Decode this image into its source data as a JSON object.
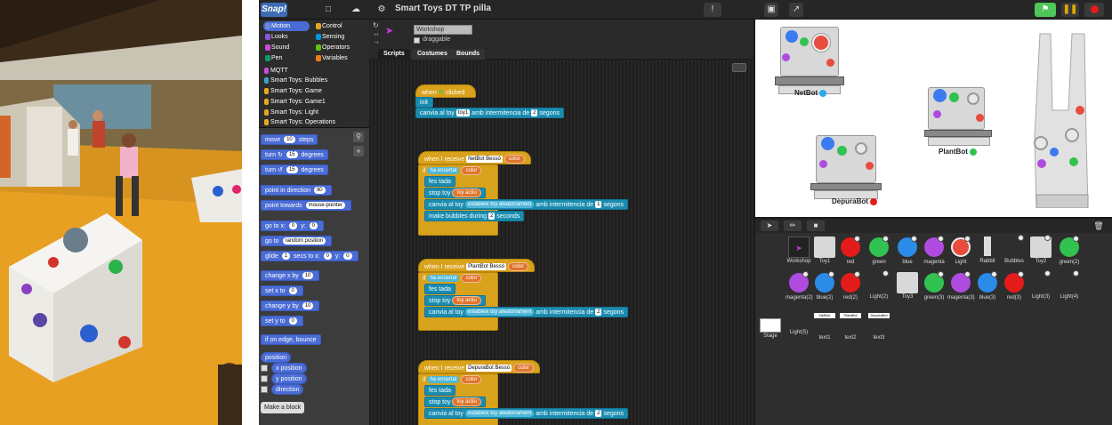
{
  "topbar": {
    "title": "Smart Toys DT TP pilla"
  },
  "categories": [
    {
      "label": "Motion",
      "color": "#4a6cd4"
    },
    {
      "label": "Control",
      "color": "#e6a822"
    },
    {
      "label": "Looks",
      "color": "#8a55d7"
    },
    {
      "label": "Sensing",
      "color": "#0494dc"
    },
    {
      "label": "Sound",
      "color": "#cf4ad9"
    },
    {
      "label": "Operators",
      "color": "#62c213"
    },
    {
      "label": "Pen",
      "color": "#0e9a6c"
    },
    {
      "label": "Variables",
      "color": "#ee7d16"
    }
  ],
  "library_categories": [
    "MQTT",
    "Smart Toys: Bubbles",
    "Smart Toys: Game",
    "Smart Toys: Game1",
    "Smart Toys: Light",
    "Smart Toys: Operations"
  ],
  "palette": {
    "move": "move",
    "move_steps": "10",
    "move_suffix": "steps",
    "turn_cw": "turn",
    "turn_cw_deg": "15",
    "turn_suffix": "degrees",
    "turn_ccw": "turn",
    "turn_ccw_deg": "15",
    "point_dir": "point in direction",
    "point_dir_val": "90",
    "point_towards": "point towards",
    "point_towards_val": "mouse-pointer",
    "goto_xy": "go to x:",
    "goto_x": "0",
    "goto_y_lbl": "y:",
    "goto_y": "0",
    "goto": "go to",
    "goto_val": "random position",
    "glide": "glide",
    "glide_secs": "1",
    "glide_mid": "secs to x:",
    "glide_x": "0",
    "glide_y_lbl": "y:",
    "glide_y": "0",
    "change_x": "change x by",
    "change_x_val": "10",
    "set_x": "set x to",
    "set_x_val": "0",
    "change_y": "change y by",
    "change_y_val": "10",
    "set_y": "set y to",
    "set_y_val": "0",
    "bounce": "if on edge, bounce",
    "position": "position",
    "x_position": "x position",
    "y_position": "y position",
    "direction": "direction",
    "make_block": "Make a block"
  },
  "sprite": {
    "name": "Workshop",
    "draggable_label": "draggable"
  },
  "tabs": [
    "Scripts",
    "Costumes",
    "Bounds"
  ],
  "scripts": {
    "s1": {
      "hat_when": "when",
      "hat_clicked": "clicked",
      "init": "init",
      "canvia_pre": "canvia al toy",
      "canvia_toy": "toy1",
      "canvia_mid": "amb intermitencia de",
      "canvia_n": "2",
      "canvia_suf": "segons"
    },
    "s2": {
      "hat": "when I receive",
      "msg": "NetBot Bessó",
      "color": "color",
      "if": "if",
      "ha": "ha encertat",
      "ha_color": "color",
      "fes": "fes tada",
      "stop": "stop toy",
      "stop_val": "toy actiu",
      "canvia": "canvia al toy",
      "canvia_val": "estableix toy aleatoriament",
      "canvia_mid": "amb intermitencia de",
      "canvia_n": "1",
      "canvia_suf": "segons",
      "bubbles": "make bubbles during",
      "bubbles_n": "2",
      "bubbles_suf": "seconds"
    },
    "s3": {
      "hat": "when I receive",
      "msg": "PlantBot Bessó",
      "color": "color",
      "if": "if",
      "ha": "ha encertat",
      "ha_color": "color",
      "fes": "fes tada",
      "stop": "stop toy",
      "stop_val": "toy actiu",
      "canvia": "canvia al toy",
      "canvia_val": "estableix toy aleatoriament",
      "canvia_mid": "amb intermitencia de",
      "canvia_n": "2",
      "canvia_suf": "segons"
    },
    "s4": {
      "hat": "when I receive",
      "msg": "DepuraBot Bessó",
      "color": "color",
      "if": "if",
      "ha": "ha encertat",
      "ha_color": "color",
      "fes": "fes tada",
      "stop": "stop toy",
      "stop_val": "toy actiu",
      "canvia": "canvia al toy",
      "canvia_val": "estableix toy aleatoriament",
      "canvia_mid": "amb intermitencia de",
      "canvia_n": "2",
      "canvia_suf": "segons"
    }
  },
  "stage_labels": {
    "netbot": "NetBot",
    "plantbot": "PlantBot",
    "depurabot": "DepuraBot"
  },
  "corral": {
    "row1": [
      "Workshop",
      "Toy1",
      "red",
      "green",
      "blue",
      "magenta",
      "Light",
      "Rabbit",
      "Bubbles",
      "Toy2",
      "green(2)"
    ],
    "row2": [
      "magenta(2)",
      "blue(2)",
      "red(2)",
      "Light(2)",
      "Toy3",
      "green(3)",
      "magenta(3)",
      "blue(3)",
      "red(3)",
      "Light(3)",
      "Light(4)"
    ],
    "row3": [
      "Light(5)",
      "text1",
      "text2",
      "text3"
    ],
    "row3_tags": [
      "NetBot",
      "PlantBot",
      "DepuraBot"
    ],
    "stage": "Stage"
  },
  "colors": {
    "accent_green": "#2ecc40",
    "stop_red": "#e31b1b",
    "pause_yellow": "#e0a800"
  }
}
